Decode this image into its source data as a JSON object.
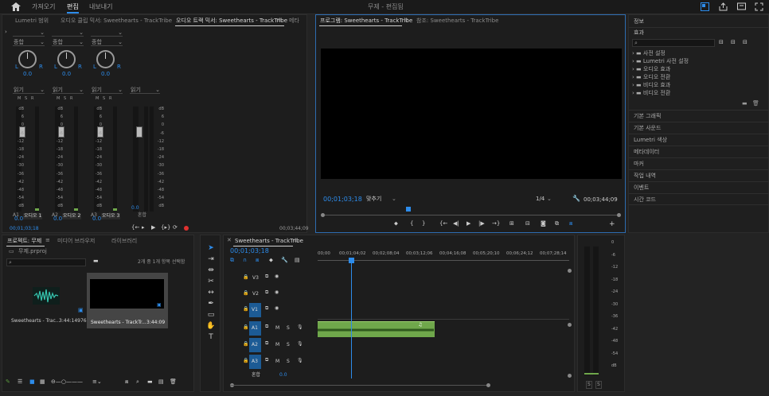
{
  "topbar": {
    "tabs": [
      "가져오기",
      "편집",
      "내보내기"
    ],
    "active_tab": "편집",
    "title": "무제 - 편집됨"
  },
  "colors": {
    "accent": "#2d8ceb",
    "clip_green": "#6fa74b",
    "record": "#e0312f"
  },
  "mixer_panel": {
    "tabs": [
      "Lumetri 범위",
      "오디오 클립 믹서: Sweethearts - TrackTribe",
      "오디오 트랙 믹서: Sweethearts - TrackTribe",
      "메타"
    ],
    "channels": [
      {
        "source": "종합",
        "pan": "0.0",
        "mode": "읽기",
        "volume": "0.0",
        "track": "A1",
        "name": "오디오 1"
      },
      {
        "source": "종합",
        "pan": "0.0",
        "mode": "읽기",
        "volume": "0.0",
        "track": "A2",
        "name": "오디오 2"
      },
      {
        "source": "종합",
        "pan": "0.0",
        "mode": "읽기",
        "volume": "0.0",
        "track": "A3",
        "name": "오디오 3"
      }
    ],
    "master": {
      "mode": "읽기",
      "volume": "0.0",
      "name": "혼합"
    },
    "msr": [
      "M",
      "S",
      "R"
    ],
    "pan_lr": [
      "L",
      "R"
    ],
    "db_scale": [
      "dB",
      "6",
      "0",
      "-6",
      "-12",
      "-18",
      "-24",
      "-30",
      "-36",
      "-42",
      "-48",
      "-54",
      "dB"
    ],
    "timecode_left": "00;01;03;18",
    "timecode_right": "00;03;44;09"
  },
  "program_monitor": {
    "tabs": [
      "프로그램: Sweethearts - TrackTribe",
      "참조: Sweethearts - TrackTribe"
    ],
    "timecode": "00;01;03;18",
    "fit": "맞추기",
    "resolution": "1/4",
    "duration": "00;03;44;09",
    "playhead_fraction": 0.29
  },
  "right_panel": {
    "info_label": "정보",
    "effects_label": "효과",
    "effects_tree": [
      "사전 설정",
      "Lumetri 사전 설정",
      "오디오 효과",
      "오디오 전환",
      "비디오 효과",
      "비디오 전환"
    ],
    "panels": [
      "기본 그래픽",
      "기본 사운드",
      "Lumetri 색상",
      "메타데이터",
      "마커",
      "작업 내역",
      "이벤트",
      "시간 코드"
    ]
  },
  "project_panel": {
    "tabs": [
      "프로젝트: 무제",
      "미디어 브라우저",
      "라이브러리"
    ],
    "file": "무제.prproj",
    "selection": "2개 중 1개 항목 선택함",
    "items": [
      {
        "name": "Sweethearts - Trac...",
        "duration": "3:44:14976"
      },
      {
        "name": "Sweethearts - TrackTr...",
        "duration": "3:44:09"
      }
    ]
  },
  "timeline": {
    "tab": "Sweethearts - TrackTribe",
    "timecode": "00;01;03;18",
    "ruler": [
      "00;00",
      "00;01;04;02",
      "00;02;08;04",
      "00;03;12;06",
      "00;04;16;08",
      "00;05;20;10",
      "00;06;24;12",
      "00;07;28;14"
    ],
    "video_tracks": [
      "V3",
      "V2",
      "V1"
    ],
    "audio_tracks": [
      "A1",
      "A2",
      "A3"
    ],
    "master_label": "혼합",
    "master_value": "0.0",
    "msr": [
      "M",
      "S"
    ],
    "playhead_fraction": 0.134,
    "clip": {
      "start_fraction": 0.0,
      "end_fraction": 0.464
    }
  },
  "audio_meter": {
    "scale": [
      "0",
      "-6",
      "-12",
      "-18",
      "-24",
      "-30",
      "-36",
      "-42",
      "-48",
      "-54",
      "dB"
    ],
    "solo": [
      "S",
      "S"
    ]
  }
}
